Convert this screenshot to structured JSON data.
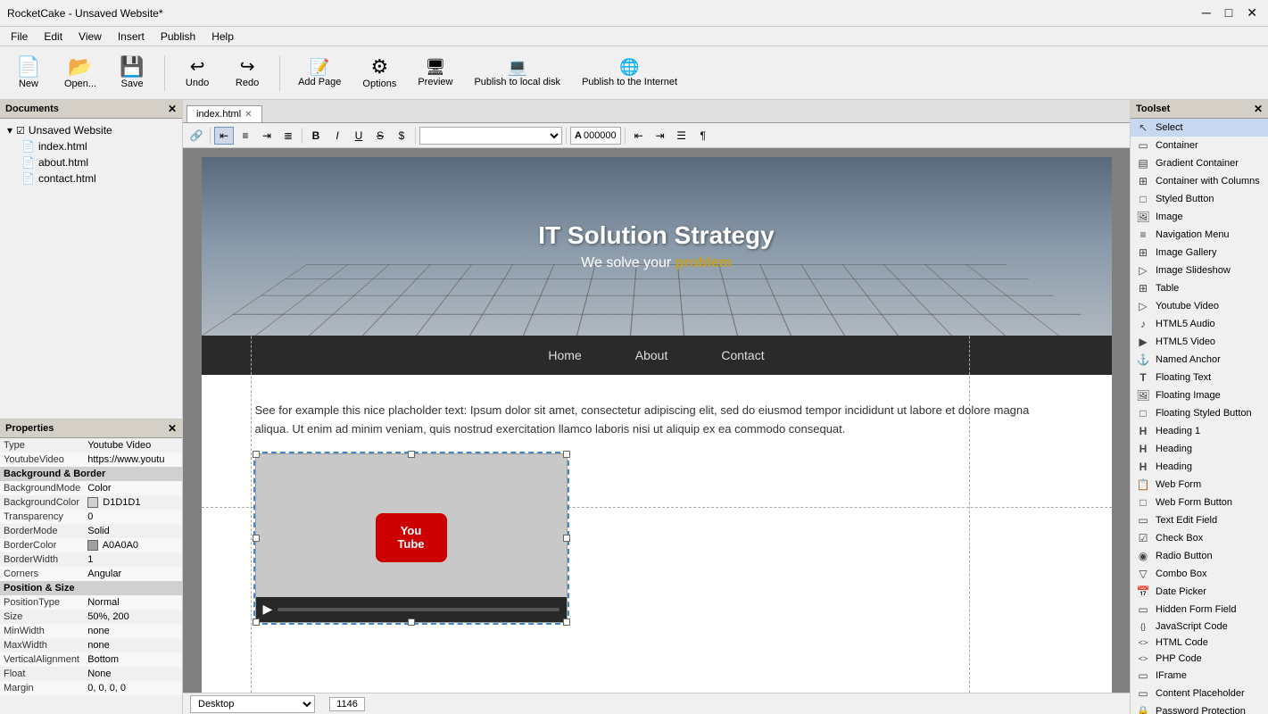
{
  "titlebar": {
    "title": "RocketCake - Unsaved Website*",
    "controls": [
      "─",
      "□",
      "✕"
    ]
  },
  "menubar": {
    "items": [
      "File",
      "Edit",
      "View",
      "Insert",
      "Publish",
      "Help"
    ]
  },
  "toolbar": {
    "buttons": [
      {
        "id": "new",
        "icon": "📄",
        "label": "New"
      },
      {
        "id": "open",
        "icon": "📂",
        "label": "Open..."
      },
      {
        "id": "save",
        "icon": "💾",
        "label": "Save"
      },
      {
        "id": "undo",
        "icon": "↩",
        "label": "Undo"
      },
      {
        "id": "redo",
        "icon": "↪",
        "label": "Redo"
      },
      {
        "id": "add-page",
        "icon": "➕",
        "label": "Add Page"
      },
      {
        "id": "options",
        "icon": "⚙",
        "label": "Options"
      },
      {
        "id": "preview",
        "icon": "🖥",
        "label": "Preview"
      },
      {
        "id": "publish-local",
        "icon": "💻",
        "label": "Publish to local disk"
      },
      {
        "id": "publish-internet",
        "icon": "🌐",
        "label": "Publish to the Internet"
      }
    ]
  },
  "documents": {
    "panel_title": "Documents",
    "root": "Unsaved Website",
    "files": [
      "index.html",
      "about.html",
      "contact.html"
    ]
  },
  "tab": {
    "name": "index.html"
  },
  "format_toolbar": {
    "link_icon": "🔗",
    "align_left": "≡",
    "align_center": "≡",
    "align_right": "≡",
    "align_justify": "≡",
    "bold": "B",
    "italic": "I",
    "underline": "U",
    "strikethrough": "S",
    "currency": "$",
    "font_placeholder": "",
    "color_label": "A",
    "color_value": "000000"
  },
  "hero": {
    "title": "IT Solution Strategy",
    "subtitle_prefix": "We solve your ",
    "subtitle_highlight": "problem"
  },
  "navbar": {
    "links": [
      "Home",
      "About",
      "Contact"
    ]
  },
  "content": {
    "text": "See for example this nice placholder text: Ipsum dolor sit amet, consectetur adipiscing elit, sed do eiusmod tempor incididunt ut labore et dolore magna aliqua. Ut enim ad minim veniam, quis nostrud exercitation llamco laboris nisi ut aliquip ex ea commodo consequat."
  },
  "properties": {
    "panel_title": "Properties",
    "type_label": "Type",
    "type_value": "Youtube Video",
    "url_label": "YoutubeVideo",
    "url_value": "https://www.youtu",
    "section_bg": "Background & Border",
    "bg_mode_label": "BackgroundMode",
    "bg_mode_value": "Color",
    "bg_color_label": "BackgroundColor",
    "bg_color_value": "D1D1D1",
    "bg_color_hex": "#D1D1D1",
    "transparency_label": "Transparency",
    "transparency_value": "0",
    "border_mode_label": "BorderMode",
    "border_mode_value": "Solid",
    "border_color_label": "BorderColor",
    "border_color_value": "A0A0A0",
    "border_color_hex": "#A0A0A0",
    "border_width_label": "BorderWidth",
    "border_width_value": "1",
    "corners_label": "Corners",
    "corners_value": "Angular",
    "section_pos": "Position & Size",
    "pos_type_label": "PositionType",
    "pos_type_value": "Normal",
    "size_label": "Size",
    "size_value": "50%, 200",
    "min_width_label": "MinWidth",
    "min_width_value": "none",
    "max_width_label": "MaxWidth",
    "max_width_value": "none",
    "v_align_label": "VerticalAlignment",
    "v_align_value": "Bottom",
    "float_label": "Float",
    "float_value": "None",
    "margin_label": "Margin",
    "margin_value": "0, 0, 0, 0"
  },
  "toolset": {
    "title": "Toolset",
    "items": [
      {
        "id": "select",
        "icon": "↖",
        "label": "Select",
        "selected": true
      },
      {
        "id": "container",
        "icon": "▭",
        "label": "Container"
      },
      {
        "id": "gradient-container",
        "icon": "▭",
        "label": "Gradient Container"
      },
      {
        "id": "container-columns",
        "icon": "⊞",
        "label": "Container with Columns"
      },
      {
        "id": "styled-button",
        "icon": "□",
        "label": "Styled Button"
      },
      {
        "id": "image",
        "icon": "🖼",
        "label": "Image"
      },
      {
        "id": "navigation-menu",
        "icon": "≡",
        "label": "Navigation Menu"
      },
      {
        "id": "image-gallery",
        "icon": "⊞",
        "label": "Image Gallery"
      },
      {
        "id": "image-slideshow",
        "icon": "▷",
        "label": "Image Slideshow"
      },
      {
        "id": "table",
        "icon": "⊞",
        "label": "Table"
      },
      {
        "id": "youtube-video",
        "icon": "▷",
        "label": "Youtube Video"
      },
      {
        "id": "html5-audio",
        "icon": "♪",
        "label": "HTML5 Audio"
      },
      {
        "id": "html5-video",
        "icon": "▶",
        "label": "HTML5 Video"
      },
      {
        "id": "named-anchor",
        "icon": "⚓",
        "label": "Named Anchor"
      },
      {
        "id": "floating-text",
        "icon": "T",
        "label": "Floating Text"
      },
      {
        "id": "floating-image",
        "icon": "🖼",
        "label": "Floating Image"
      },
      {
        "id": "floating-styled-button",
        "icon": "□",
        "label": "Floating Styled Button"
      },
      {
        "id": "heading1",
        "icon": "H",
        "label": "Heading 1"
      },
      {
        "id": "heading2",
        "icon": "H",
        "label": "Heading"
      },
      {
        "id": "heading3",
        "icon": "H",
        "label": "Heading"
      },
      {
        "id": "web-form",
        "icon": "📋",
        "label": "Web Form"
      },
      {
        "id": "web-form-button",
        "icon": "□",
        "label": "Web Form Button"
      },
      {
        "id": "text-edit-field",
        "icon": "▭",
        "label": "Text Edit Field"
      },
      {
        "id": "check-box",
        "icon": "☑",
        "label": "Check Box"
      },
      {
        "id": "radio-button",
        "icon": "◉",
        "label": "Radio Button"
      },
      {
        "id": "combo-box",
        "icon": "▽",
        "label": "Combo Box"
      },
      {
        "id": "date-picker",
        "icon": "📅",
        "label": "Date Picker"
      },
      {
        "id": "hidden-form-field",
        "icon": "▭",
        "label": "Hidden Form Field"
      },
      {
        "id": "javascript-code",
        "icon": "{ }",
        "label": "JavaScript Code"
      },
      {
        "id": "html-code",
        "icon": "< >",
        "label": "HTML Code"
      },
      {
        "id": "php-code",
        "icon": "< >",
        "label": "PHP Code"
      },
      {
        "id": "iframe",
        "icon": "▭",
        "label": "IFrame"
      },
      {
        "id": "content-placeholder",
        "icon": "▭",
        "label": "Content Placeholder"
      },
      {
        "id": "password-protection",
        "icon": "🔒",
        "label": "Password Protection"
      }
    ]
  },
  "statusbar": {
    "view_label": "Desktop",
    "page_width": "1146"
  }
}
